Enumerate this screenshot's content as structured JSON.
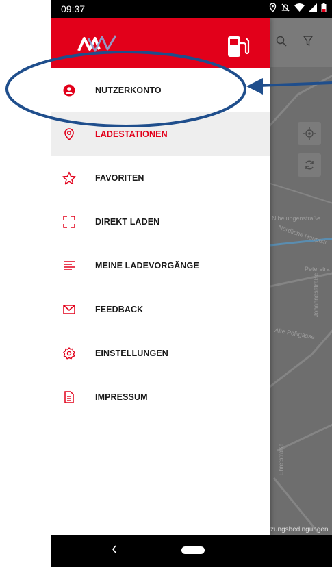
{
  "status_bar": {
    "time": "09:37",
    "icons": [
      "location-icon",
      "mute-icon",
      "wifi-icon",
      "signal-icon",
      "battery-icon"
    ]
  },
  "drawer": {
    "logo": "mw-logo",
    "header_icon": "ev-charger-icon",
    "items": [
      {
        "label": "NUTZERKONTO",
        "icon": "account-icon",
        "active": false
      },
      {
        "label": "LADESTATIONEN",
        "icon": "map-pin-icon",
        "active": true
      },
      {
        "label": "FAVORITEN",
        "icon": "star-icon",
        "active": false
      },
      {
        "label": "DIREKT LADEN",
        "icon": "scan-icon",
        "active": false
      },
      {
        "label": "MEINE LADEVORGÄNGE",
        "icon": "list-icon",
        "active": false
      },
      {
        "label": "FEEDBACK",
        "icon": "mail-icon",
        "active": false
      },
      {
        "label": "EINSTELLUNGEN",
        "icon": "gear-icon",
        "active": false
      },
      {
        "label": "IMPRESSUM",
        "icon": "document-icon",
        "active": false
      }
    ]
  },
  "map": {
    "streets": [
      "Nibelungenstraße",
      "Nördliche Hauptstr",
      "Peterstra",
      "Alte Poliigasse",
      "Johannesstraße",
      "Ehretstraße"
    ],
    "terms": "zungsbedingungen"
  },
  "colors": {
    "brand_red": "#e2001a",
    "annotation_blue": "#1f4e8c"
  }
}
